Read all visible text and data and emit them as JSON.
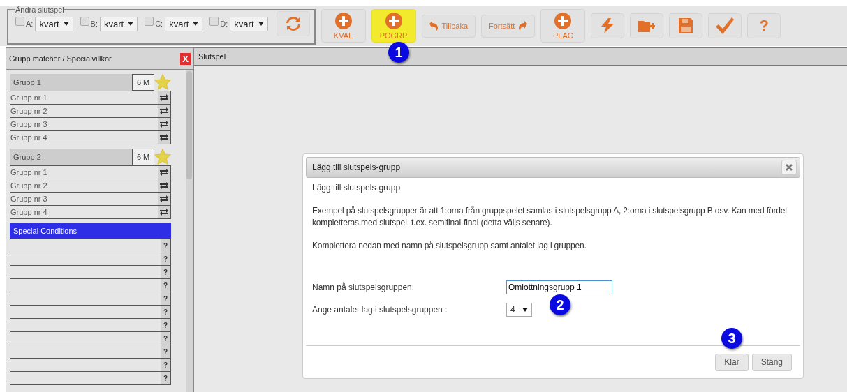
{
  "toolbar": {
    "legend": "Ändra slutspel",
    "slots": [
      {
        "label": "A:",
        "checked": false,
        "value": "kvart"
      },
      {
        "label": "B:",
        "checked": false,
        "value": "kvart"
      },
      {
        "label": "C:",
        "checked": false,
        "value": "kvart"
      },
      {
        "label": "D:",
        "checked": false,
        "value": "kvart"
      }
    ],
    "buttons": [
      {
        "kind": "add",
        "label": "KVAL",
        "highlighted": false
      },
      {
        "kind": "add",
        "label": "POGRP",
        "highlighted": true
      },
      {
        "kind": "back",
        "label": "Tillbaka"
      },
      {
        "kind": "forward",
        "label": "Fortsätt"
      },
      {
        "kind": "add",
        "label": "PLAC",
        "highlighted": false
      },
      {
        "kind": "bolt"
      },
      {
        "kind": "folder-add"
      },
      {
        "kind": "save"
      },
      {
        "kind": "check"
      },
      {
        "kind": "help",
        "label": "?"
      }
    ]
  },
  "left_panel": {
    "title": "Grupp matcher / Specialvillkor",
    "close": "X",
    "groups": [
      {
        "name": "Grupp 1",
        "badge": "6 M",
        "starred": true,
        "rows": [
          "Grupp nr 1",
          "Grupp nr 2",
          "Grupp nr 3",
          "Grupp nr 4"
        ]
      },
      {
        "name": "Grupp 2",
        "badge": "6 M",
        "starred": true,
        "rows": [
          "Grupp nr 1",
          "Grupp nr 2",
          "Grupp nr 3",
          "Grupp nr 4"
        ]
      }
    ],
    "special": {
      "title": "Special Conditions",
      "rows": [
        "?",
        "?",
        "?",
        "?",
        "?",
        "?",
        "?",
        "?",
        "?",
        "?",
        "?"
      ]
    }
  },
  "right_panel": {
    "title": "Slutspel"
  },
  "dialog": {
    "title": "Lägg till slutspels-grupp",
    "subtitle": "Lägg till slutspels-grupp",
    "paragraphs": [
      "Exempel på slutspelsgrupper är att 1:orna från gruppspelet samlas i slutspelsgrupp A, 2:orna i slutspelsgrupp B osv. Kan med fördel kompletteras med slutspel, t.ex. semifinal-final (detta väljs senare).",
      "Komplettera nedan med namn på slutspelsgrupp samt antalet lag i gruppen."
    ],
    "fields": [
      {
        "kind": "text",
        "label": "Namn på slutspelsgruppen:",
        "value": "Omlottningsgrupp 1"
      },
      {
        "kind": "select",
        "label": "Ange antalet lag i slutspelsgruppen :",
        "value": "4"
      }
    ],
    "buttons": [
      "Klar",
      "Stäng"
    ]
  },
  "markers": [
    "1",
    "2",
    "3"
  ]
}
